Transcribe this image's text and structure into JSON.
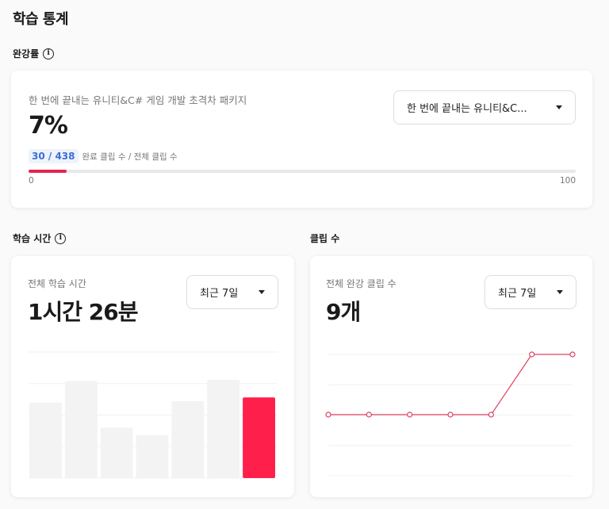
{
  "page": {
    "title": "학습 통계"
  },
  "completion": {
    "label": "완강률",
    "course_title": "한 번에 끝내는 유니티&C# 게임 개발 초격차 패키지",
    "percent_text": "7%",
    "badge": "30 / 438",
    "badge_caption": "완료 클립 수 / 전체 클립 수",
    "progress_fraction": 0.07,
    "scale_min": "0",
    "scale_max": "100",
    "dropdown_value": "한 번에 끝내는 유니티&C..."
  },
  "study_time": {
    "label": "학습 시간",
    "caption": "전체 학습 시간",
    "value": "1시간 26분",
    "dropdown_value": "최근 7일"
  },
  "clips": {
    "label": "클립 수",
    "caption": "전체 완강 클립 수",
    "value": "9개",
    "dropdown_value": "최근 7일"
  },
  "colors": {
    "accent": "#ff1f4b",
    "bar": "#f3f3f3",
    "line": "#e0405e"
  },
  "chart_data": [
    {
      "type": "bar",
      "categories": [
        "1",
        "2",
        "3",
        "4",
        "5",
        "6",
        "7"
      ],
      "values": [
        60,
        77,
        40,
        34,
        61,
        78,
        64
      ],
      "highlight_index": 6,
      "grid": true,
      "axis_labels": false
    },
    {
      "type": "line",
      "x": [
        1,
        2,
        3,
        4,
        5,
        6,
        7
      ],
      "values": [
        0,
        0,
        0,
        0,
        0,
        1,
        1
      ],
      "grid": true,
      "axis_labels": false
    }
  ]
}
